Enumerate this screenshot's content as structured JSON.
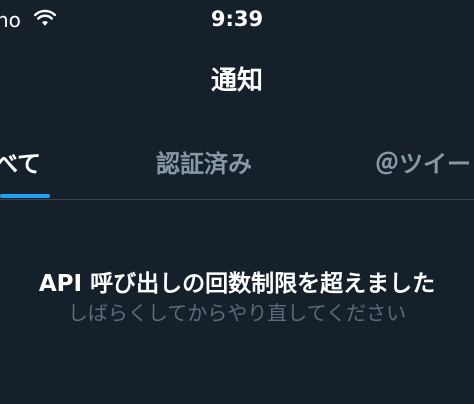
{
  "status_bar": {
    "carrier": "no",
    "wifi_icon": "wifi-icon",
    "time": "9:39"
  },
  "header": {
    "title": "通知"
  },
  "tabs": [
    {
      "label": "べて",
      "active": true
    },
    {
      "label": "認証済み",
      "active": false
    },
    {
      "label": "＠ツイー",
      "active": false
    }
  ],
  "message": {
    "title": "API 呼び出しの回数制限を超えました",
    "subtitle": "しばらくしてからやり直してください"
  },
  "colors": {
    "background": "#15202b",
    "accent": "#1da1f2",
    "text_primary": "#ffffff",
    "text_secondary": "#8899a6",
    "divider": "#38444d"
  }
}
